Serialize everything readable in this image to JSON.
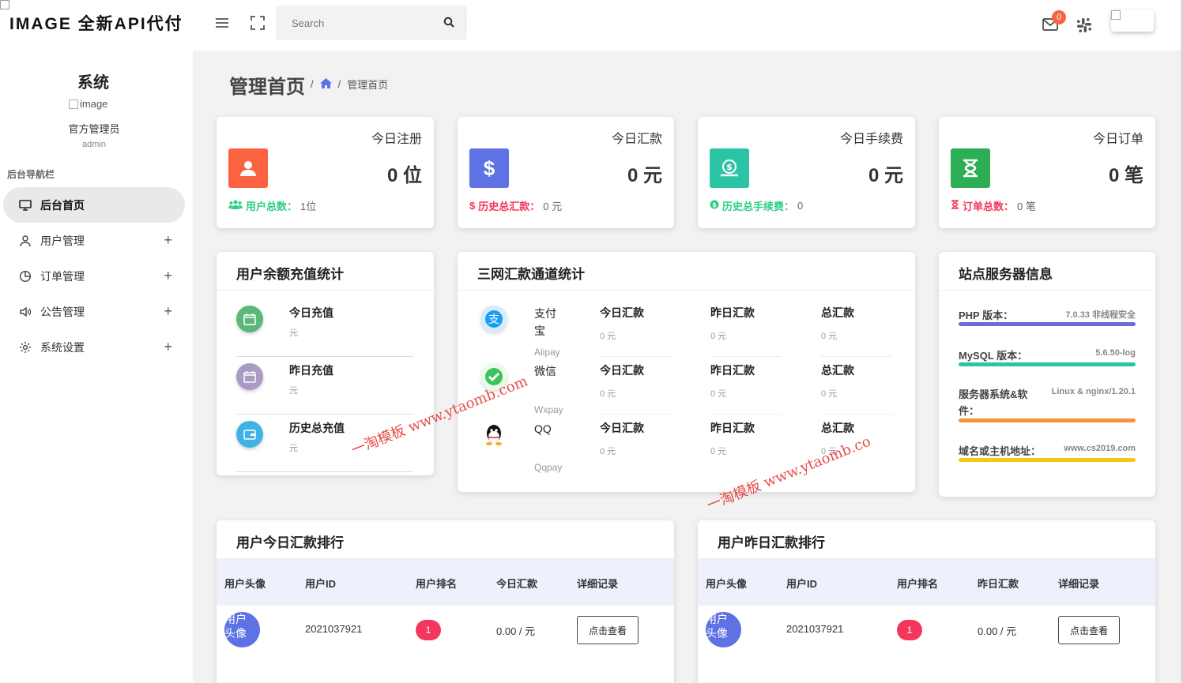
{
  "app": {
    "logo_text": "IMAGE 全新API代付",
    "system_name": "系统",
    "avatar_alt": "image",
    "admin_name": "官方管理员",
    "admin_role": "admin"
  },
  "sidebar": {
    "nav_title": "后台导航栏",
    "items": [
      {
        "label": "后台首页",
        "icon": "monitor-icon",
        "active": true
      },
      {
        "label": "用户管理",
        "icon": "user-icon",
        "expandable": true
      },
      {
        "label": "订单管理",
        "icon": "pie-chart-icon",
        "expandable": true
      },
      {
        "label": "公告管理",
        "icon": "speaker-icon",
        "expandable": true
      },
      {
        "label": "系统设置",
        "icon": "gear-icon",
        "expandable": true
      }
    ]
  },
  "topbar": {
    "search_placeholder": "Search",
    "mail_count": "0"
  },
  "page": {
    "title": "管理首页",
    "breadcrumb": "管理首页"
  },
  "stats": [
    {
      "label": "今日注册",
      "value": "0 位",
      "foot_label": "用户总数：",
      "foot_value": "1位",
      "color": "#fb6340",
      "foot_color": "#2dce89"
    },
    {
      "label": "今日汇款",
      "value": "0 元",
      "foot_label": "历史总汇款：",
      "foot_value": "0 元",
      "color": "#5e72e4",
      "foot_color": "#f5365c"
    },
    {
      "label": "今日手续费",
      "value": "0 元",
      "foot_label": "历史总手续费：",
      "foot_value": "0",
      "color": "#2bc4a4",
      "foot_color": "#2dce89"
    },
    {
      "label": "今日订单",
      "value": "0 笔",
      "foot_label": "订单总数：",
      "foot_value": "0 笔",
      "color": "#2dae55",
      "foot_color": "#f5365c"
    }
  ],
  "recharge": {
    "title": "用户余额充值统计",
    "rows": [
      {
        "name": "今日充值",
        "value": "元"
      },
      {
        "name": "昨日充值",
        "value": "元"
      },
      {
        "name": "历史总充值",
        "value": "元"
      }
    ]
  },
  "channels": {
    "title": "三网汇款通道统计",
    "col_labels": [
      "今日汇款",
      "昨日汇款",
      "总汇款"
    ],
    "rows": [
      {
        "name": "支付宝",
        "code": "Alipay",
        "values": [
          "0 元",
          "0 元",
          "0 元"
        ]
      },
      {
        "name": "微信",
        "code": "Wxpay",
        "values": [
          "0 元",
          "0 元",
          "0 元"
        ]
      },
      {
        "name": "QQ",
        "code": "Qqpay",
        "values": [
          "0 元",
          "0 元",
          "0 元"
        ]
      }
    ]
  },
  "server": {
    "title": "站点服务器信息",
    "items": [
      {
        "key": "PHP 版本：",
        "value": "7.0.33 非线程安全",
        "color": "#6f6ad6"
      },
      {
        "key": "MySQL 版本：",
        "value": "5.6.50-log",
        "color": "#2bc4a4"
      },
      {
        "key": "服务器系统&软件：",
        "value": "Linux & nginx/1.20.1",
        "color": "#f3953a"
      },
      {
        "key": "域名或主机地址：",
        "value": "www.cs2019.com",
        "color": "#f5c518"
      }
    ]
  },
  "rank_today": {
    "title": "用户今日汇款排行",
    "headers": [
      "用户头像",
      "用户ID",
      "用户排名",
      "今日汇款",
      "详细记录"
    ],
    "row": {
      "avatar_alt": "用户头像",
      "id": "2021037921",
      "rank": "1",
      "amount": "0.00 / 元",
      "button": "点击查看"
    }
  },
  "rank_yesterday": {
    "title": "用户昨日汇款排行",
    "headers": [
      "用户头像",
      "用户ID",
      "用户排名",
      "昨日汇款",
      "详细记录"
    ],
    "row": {
      "avatar_alt": "用户头像",
      "id": "2021037921",
      "rank": "1",
      "amount": "0.00 / 元",
      "button": "点击查看"
    }
  },
  "watermarks": [
    "一淘模板 www.ytaomb.com",
    "一淘模板 www.ytaomb.co"
  ]
}
